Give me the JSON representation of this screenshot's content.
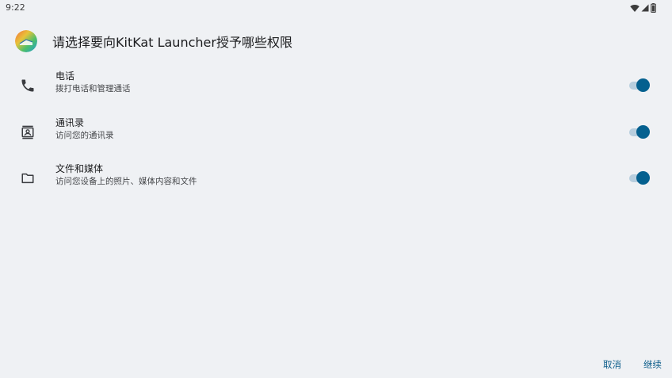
{
  "status_bar": {
    "time": "9:22",
    "icons": [
      "wifi-icon",
      "signal-icon",
      "battery-icon"
    ]
  },
  "header": {
    "app_icon": "kitkat-launcher-app-icon",
    "title": "请选择要向KitKat Launcher授予哪些权限"
  },
  "permissions": [
    {
      "icon": "phone-icon",
      "title": "电话",
      "subtitle": "拨打电话和管理通话",
      "enabled": true
    },
    {
      "icon": "contacts-icon",
      "title": "通讯录",
      "subtitle": "访问您的通讯录",
      "enabled": true
    },
    {
      "icon": "folder-icon",
      "title": "文件和媒体",
      "subtitle": "访问您设备上的照片、媒体内容和文件",
      "enabled": true
    }
  ],
  "footer": {
    "cancel_label": "取消",
    "continue_label": "继续"
  },
  "colors": {
    "background": "#eff1f4",
    "accent": "#04608f",
    "toggle_track": "#b8cede",
    "button_text": "#0e5e8b"
  }
}
